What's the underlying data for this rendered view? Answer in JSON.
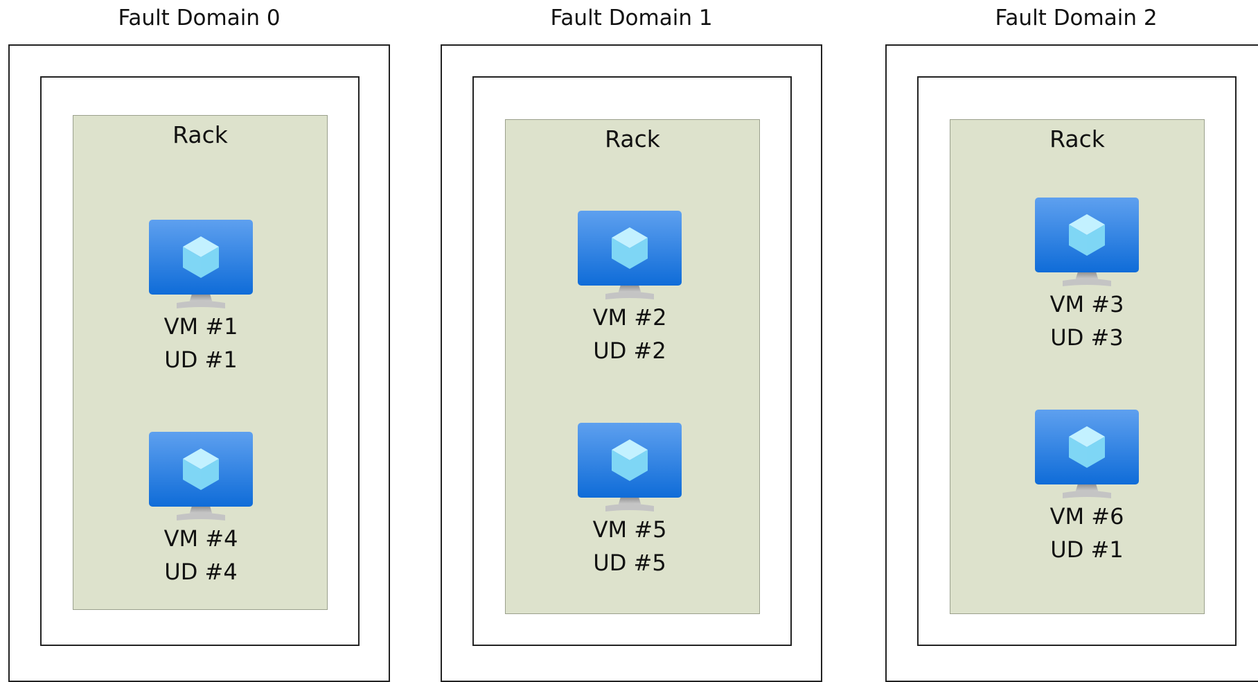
{
  "fault_domains": [
    {
      "title": "Fault Domain 0",
      "rack_label": "Rack",
      "vms": [
        {
          "vm": "VM #1",
          "ud": "UD #1"
        },
        {
          "vm": "VM #4",
          "ud": "UD #4"
        }
      ]
    },
    {
      "title": "Fault Domain 1",
      "rack_label": "Rack",
      "vms": [
        {
          "vm": "VM #2",
          "ud": "UD #2"
        },
        {
          "vm": "VM #5",
          "ud": "UD #5"
        }
      ]
    },
    {
      "title": "Fault Domain 2",
      "rack_label": "Rack",
      "vms": [
        {
          "vm": "VM #3",
          "ud": "UD #3"
        },
        {
          "vm": "VM #6",
          "ud": "UD #1"
        }
      ]
    }
  ],
  "icons": {
    "vm": "virtual-machine-icon"
  },
  "colors": {
    "rack_fill": "#dde2cc",
    "border": "#222222",
    "monitor_blue": "#2a7fe0"
  }
}
